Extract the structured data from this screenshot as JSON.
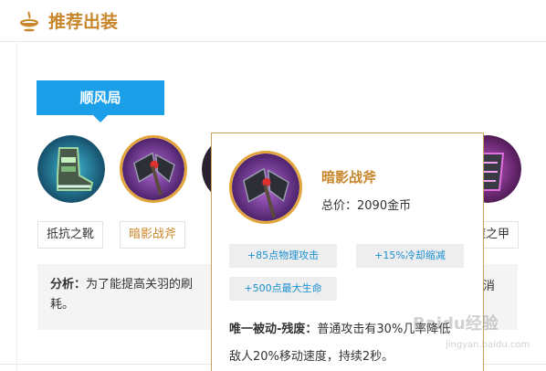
{
  "header": {
    "title": "推荐出装",
    "icon": "bowl-icon"
  },
  "tabs": [
    {
      "label": "顺风局",
      "active": true
    }
  ],
  "items": [
    {
      "name": "抵抗之靴",
      "icon": "boots-icon"
    },
    {
      "name": "暗影战斧",
      "icon": "axe-icon",
      "selected": true
    },
    {
      "name": "",
      "icon": "item-icon"
    },
    {
      "name": "",
      "icon": "item-icon"
    },
    {
      "name": "",
      "icon": "item-icon"
    },
    {
      "name": "魔之甲",
      "label_visible": "魔之甲",
      "icon": "armor-icon"
    }
  ],
  "labels": {
    "item0": "抵抗之靴",
    "item1": "暗影战斧",
    "item5_partial": "魔之甲"
  },
  "analysis": {
    "label": "分析：",
    "text": "为了能提高关羽的刷",
    "continued": "耗。",
    "tail": "消"
  },
  "tooltip": {
    "name": "暗影战斧",
    "price": "总价：2090金币",
    "stats": [
      "+85点物理攻击",
      "+15%冷却缩减",
      "+500点最大生命"
    ],
    "passive_name": "唯一被动-残废：",
    "passive_text_1": "普通攻击有30%几率降低",
    "passive_text_2": "敌人20%移动速度，持续2秒。"
  },
  "watermark": {
    "text": "Baidu经验",
    "url": "jingyan.baidu.com"
  },
  "colors": {
    "accent": "#c8862a",
    "tab": "#1a9fe8",
    "stat": "#1a8fd0",
    "border": "#c8a25a"
  }
}
